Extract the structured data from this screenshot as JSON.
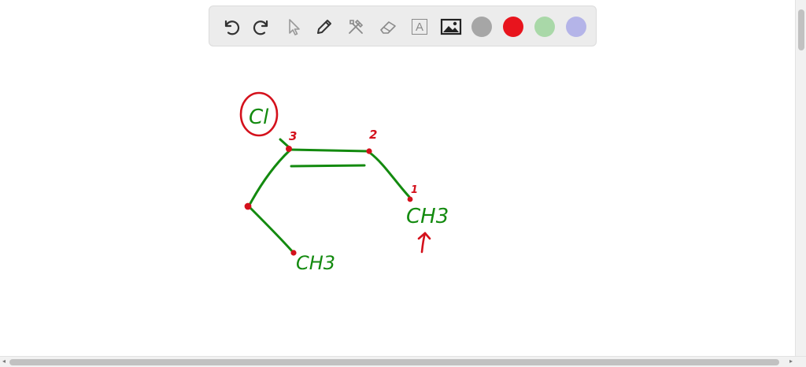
{
  "toolbar": {
    "tools": [
      {
        "icon": "undo-icon"
      },
      {
        "icon": "redo-icon"
      },
      {
        "icon": "select-pointer-icon"
      },
      {
        "icon": "pencil-icon"
      },
      {
        "icon": "tools-icon"
      },
      {
        "icon": "eraser-icon"
      },
      {
        "icon": "text-icon",
        "glyph": "A"
      },
      {
        "icon": "image-icon"
      }
    ],
    "colors": [
      "#a6a6a6",
      "#e8141d",
      "#a9d8a8",
      "#b4b4e8"
    ]
  },
  "drawing": {
    "stroke_green": "#138a0f",
    "stroke_red": "#d4111c",
    "labels": {
      "cl": "Cl",
      "ch3_left": "CH3",
      "ch3_right": "CH3",
      "num_1": "1",
      "num_2": "2",
      "num_3": "3"
    }
  }
}
